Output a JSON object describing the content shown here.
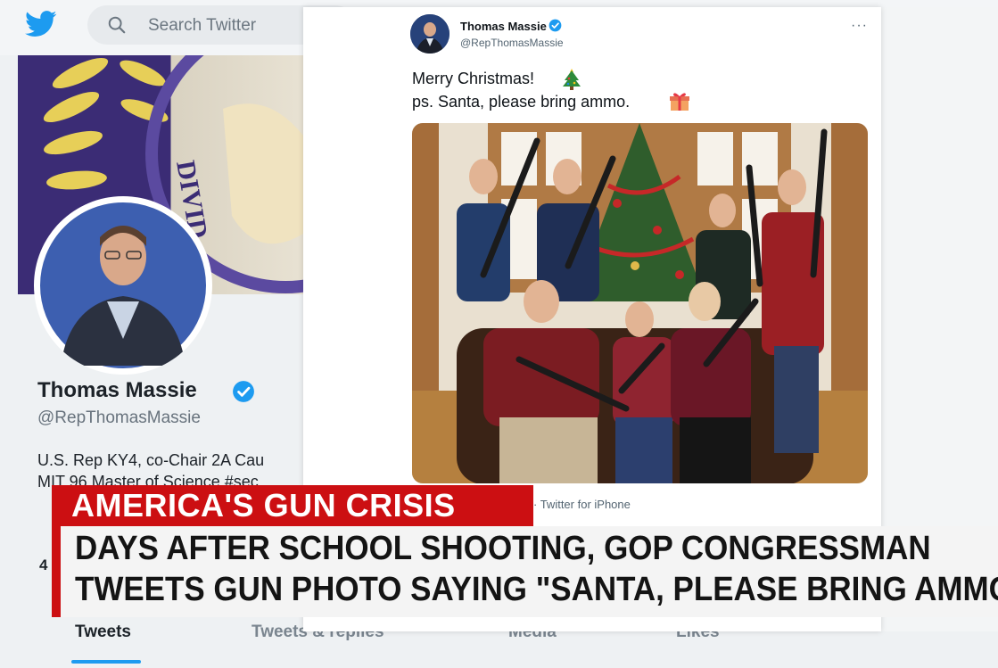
{
  "background": {
    "search_placeholder": "Search Twitter",
    "profile_name": "Thomas Massie",
    "profile_handle": "@RepThomasMassie",
    "bio_line1": "U.S. Rep KY4, co-Chair 2A Cau",
    "bio_line2": "MIT 96 Master of Science #sec",
    "tabs": [
      "Tweets",
      "Tweets & replies",
      "Media",
      "Likes"
    ],
    "partial_counter": "4"
  },
  "tweet": {
    "author": "Thomas Massie",
    "handle": "@RepThomasMassie",
    "more": "···",
    "line1": "Merry Christmas!",
    "line2": "ps. Santa, please bring ammo.",
    "source": "· Twitter for iPhone"
  },
  "chyron": {
    "label": "AMERICA'S GUN CRISIS",
    "headline_line1": "DAYS AFTER SCHOOL SHOOTING, GOP CONGRESSMAN",
    "headline_line2": "TWEETS GUN PHOTO SAYING \"SANTA, PLEASE BRING AMMO"
  },
  "colors": {
    "twitter_blue": "#1d9bf0",
    "chyron_red": "#cc0f12"
  },
  "icons": {
    "logo": "twitter-bird-icon",
    "search": "search-icon",
    "verified": "verified-badge-icon",
    "tree": "christmas-tree-emoji",
    "gift": "gift-emoji"
  }
}
